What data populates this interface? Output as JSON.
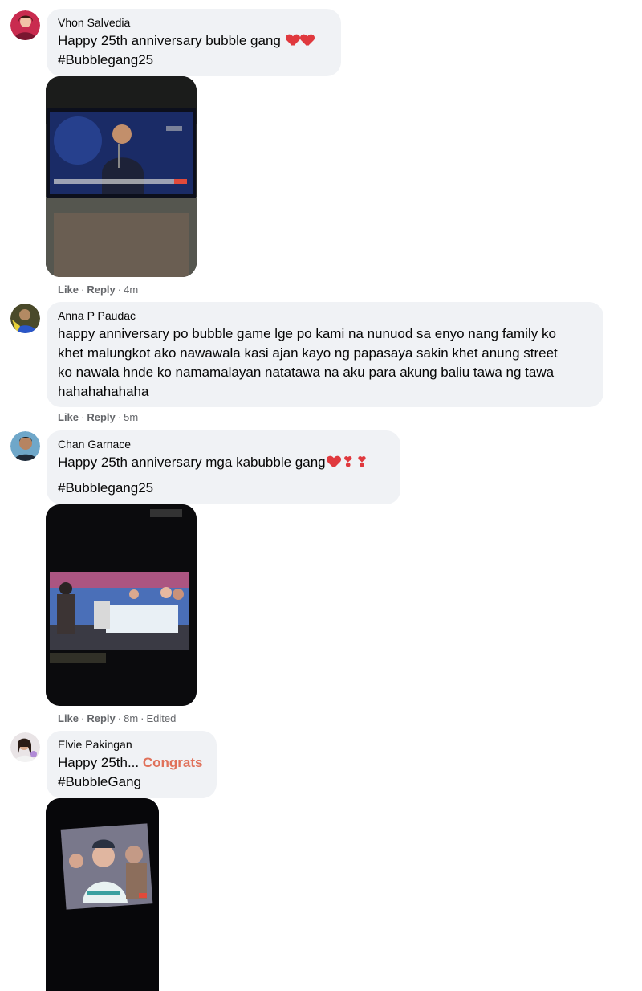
{
  "comments": [
    {
      "author": "Vhon Salvedia",
      "text": "Happy 25th anniversary bubble gang",
      "hashtag": "#Bubblegang25",
      "emoji": "heart-icon",
      "actions": {
        "like": "Like",
        "reply": "Reply",
        "time": "4m"
      }
    },
    {
      "author": "Anna P Paudac",
      "lines": [
        "happy anniversary po bubble game lge po kami na nunuod sa enyo nang family ko",
        "khet malungkot ako nawawala kasi ajan kayo ng papasaya sakin khet anung street",
        "ko nawala hnde ko namamalayan natatawa na aku para akung baliu tawa ng tawa",
        "hahahahahaha"
      ],
      "actions": {
        "like": "Like",
        "reply": "Reply",
        "time": "5m"
      }
    },
    {
      "author": "Chan Garnace",
      "text": "Happy 25th anniversary mga kabubble gang",
      "hashtag": "#Bubblegang25",
      "actions": {
        "like": "Like",
        "reply": "Reply",
        "time": "8m",
        "edited": "Edited"
      }
    },
    {
      "author": "Elvie Pakingan",
      "text": "Happy 25th...",
      "highlight": "Congrats",
      "hashtag": "#BubbleGang"
    }
  ],
  "colors": {
    "bubble": "#f0f2f5",
    "meta": "#65676b",
    "heart": "#e0393e",
    "congrats": "#e0715a"
  }
}
